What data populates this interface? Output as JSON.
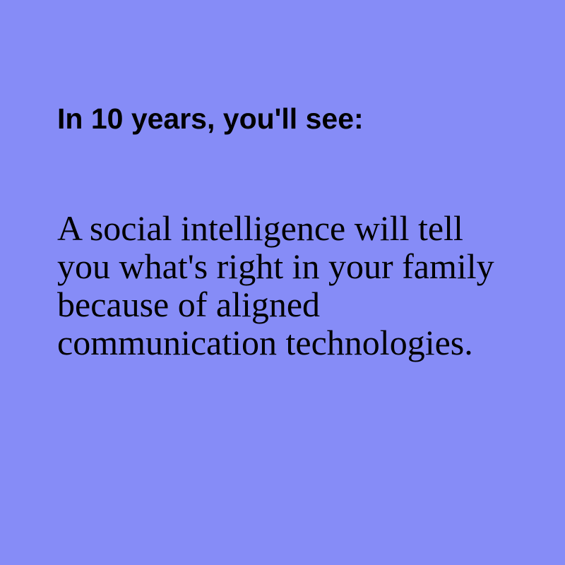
{
  "card": {
    "heading": "In 10 years, you'll see:",
    "body": "A social intelligence will tell you what's right in your family because of aligned communication technologies."
  },
  "colors": {
    "background": "#868cf7",
    "text": "#000000"
  }
}
